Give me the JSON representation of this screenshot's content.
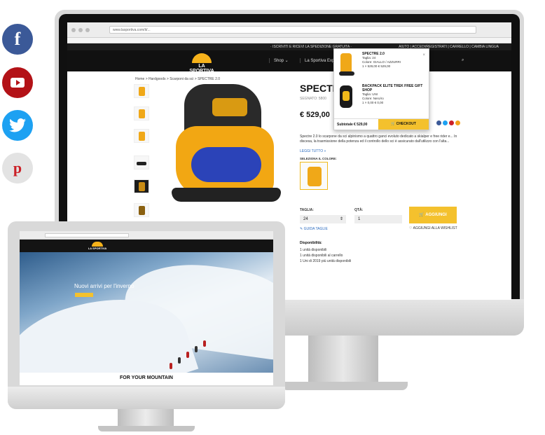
{
  "social": {
    "facebook_glyph": "f",
    "pinterest_glyph": "p",
    "colors": {
      "facebook": "#3b5998",
      "youtube": "#b31217",
      "twitter": "#1da1f2",
      "pinterest": "#cb2027"
    }
  },
  "browser": {
    "url": "www.lasportiva.com/it/..."
  },
  "site": {
    "top_message": "· ISCRIVITI E RICEVI LA SPEDIZIONE GRATUITA ·",
    "top_links": "AIUTO  |  ACCEDI/REGISTRATI  |  CARRELLO  |  CAMBIA LINGUA",
    "logo": "LA SPORTIVA",
    "nav_shop": "Shop ⌄",
    "nav_experience": "La Sportiva Experience ⌄",
    "accent": "#f4c12d"
  },
  "product": {
    "breadcrumb": "Home > Hardgoods > Scarponi da sci > SPECTRE 2.0",
    "title": "SPECTRE",
    "sku": "SEGNATO: 5800",
    "price": "€ 529,00",
    "description": "Spectre 2.0 lo scarpone da sci alpinismo a quattro ganci evoluto dedicato a skialper e free rider e... In discesa, la trasmissione della potenza ed il controllo dello sci è assicurato dall'utilizzo con l'alta...",
    "read_more": "LEGGI TUTTO »",
    "select_color": "SELEZIONA IL COLORE:",
    "size_label": "TAGLIA:",
    "size_value": "24",
    "size_guide": "GUIDA TAGLIE",
    "qty_label": "QTÀ:",
    "qty_value": "1",
    "add_to_cart": "AGGIUNGI",
    "wishlist": "AGGIUNGI ALLA WISHLIST",
    "availability_title": "Disponibilità:",
    "availability": [
      "1 unità disponibili",
      "1 unità disponibili al carrello",
      "1 Uni di 2019 più unità disponibili"
    ]
  },
  "cart": {
    "items": [
      {
        "name": "SPECTRE 2.0",
        "size": "Taglia: 24",
        "color": "Colore: GIALLO / AZZURRI",
        "price": "1 × 529,00 € 529,00"
      },
      {
        "name": "BACKPACK ELITE TREK FREE GIFT SHOP",
        "size": "Taglia: UNI",
        "color": "Colore: Nero/ro",
        "price": "1 × 0,00 € 0,00"
      }
    ],
    "subtotal_label": "Subtotale",
    "subtotal_value": "€ 529,00",
    "checkout": "CHECKOUT"
  },
  "small_site": {
    "logo": "LA SPORTIVA",
    "hero_title": "Nuovi arrivi per l'inverno",
    "tagline": "FOR YOUR MOUNTAIN"
  }
}
